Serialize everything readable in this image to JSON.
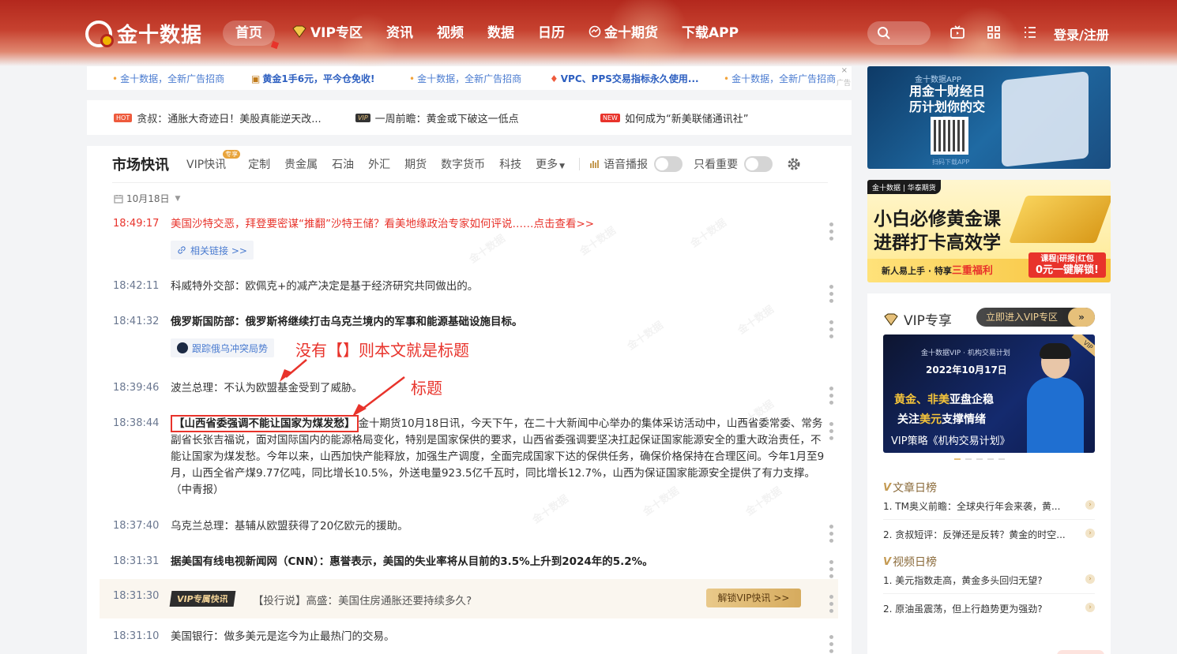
{
  "header": {
    "logo_text": "金十数据",
    "nav": [
      {
        "label": "首页",
        "active": true
      },
      {
        "label": "VIP专区",
        "icon": "vip-diamond-icon"
      },
      {
        "label": "资讯"
      },
      {
        "label": "视频"
      },
      {
        "label": "数据"
      },
      {
        "label": "日历"
      },
      {
        "label": "金十期货",
        "icon": "futures-icon"
      },
      {
        "label": "下载APP"
      }
    ],
    "login_label": "登录/注册",
    "icons": [
      "search-icon",
      "tv-icon",
      "grid-icon",
      "list-icon"
    ],
    "accent": "#c0392b"
  },
  "ad_bar": {
    "items": [
      "金十数据，全新广告招商",
      "黄金1手6元，平今仓免收!",
      "金十数据，全新广告招商",
      "VPC、PPS交易指标永久使用...",
      "金十数据，全新广告招商"
    ],
    "close": "×",
    "tag": "广告"
  },
  "headlines": [
    {
      "tag": "HOT",
      "text": "贪叔：通胀大奇迹日！美股真能逆天改..."
    },
    {
      "tag": "VIP",
      "text": "一周前瞻：黄金或下破这一低点"
    },
    {
      "tag": "NEW",
      "text": "如何成为“新美联储通讯社”"
    }
  ],
  "flash": {
    "tabs": [
      "市场快讯",
      "VIP快讯",
      "定制",
      "贵金属",
      "石油",
      "外汇",
      "期货",
      "数字货币",
      "科技",
      "更多"
    ],
    "vip_sup": "专享",
    "voice_label": "语音播报",
    "important_label": "只看重要",
    "date": "10月18日",
    "items": [
      {
        "time": "18:49:17",
        "text": "美国沙特交恶，拜登要密谋“推翻”沙特王储？看美地缘政治专家如何评说……点击查看>>",
        "chip": "相关链接 >>"
      },
      {
        "time": "18:42:11",
        "text": "科威特外交部：欧佩克+的减产决定是基于经济研究共同做出的。"
      },
      {
        "time": "18:41:32",
        "text": "俄罗斯国防部：俄罗斯将继续打击乌克兰境内的军事和能源基础设施目标。",
        "chip": "跟踪俄乌冲突局势"
      },
      {
        "time": "18:39:46",
        "text": "波兰总理：不认为欧盟基金受到了威胁。"
      },
      {
        "time": "18:38:44",
        "title": "【山西省委强调不能让国家为煤发愁】",
        "text": "金十期货10月18日讯，今天下午，在二十大新闻中心举办的集体采访活动中，山西省委常委、常务副省长张吉福说，面对国际国内的能源格局变化，特别是国家保供的要求，山西省委强调要坚决扛起保证国家能源安全的重大政治责任，不能让国家为煤发愁。今年以来，山西加快产能释放，加强生产调度，全面完成国家下达的保供任务，确保价格保持在合理区间。今年1月至9月，山西全省产煤9.77亿吨，同比增长10.5%，外送电量923.5亿千瓦时，同比增长12.7%，山西为保证国家能源安全提供了有力支撑。（中青报）"
      },
      {
        "time": "18:37:40",
        "text": "乌克兰总理：基辅从欧盟获得了20亿欧元的援助。"
      },
      {
        "time": "18:31:31",
        "text": "据美国有线电视新闻网（CNN）：惠誉表示，美国的失业率将从目前的3.5%上升到2024年的5.2%。"
      },
      {
        "time": "18:31:30",
        "badge": "VIP专属快讯",
        "text": "【投行说】高盛：美国住房通胀还要持续多久?",
        "button": "解锁VIP快讯 >>"
      },
      {
        "time": "18:31:10",
        "text": "美国银行：做多美元是迄今为止最热门的交易。"
      }
    ],
    "watermark": "金十数据"
  },
  "annotations": {
    "a1": "没有【】则本文就是标题",
    "a2": "标题"
  },
  "sidebar": {
    "banner1": {
      "small": "金十数据APP",
      "title": "用金十财经日历计划你的交易",
      "foot": "扫码下载APP"
    },
    "banner2": {
      "brand": "金十数据 | 华泰期货",
      "line1": "小白必修黄金课",
      "line2": "进群打卡高效学",
      "strip_a": "新人易上手 · 特享",
      "strip_b": "三重福利",
      "btn1": "课程|研报|红包",
      "btn2": "0元一键解锁!"
    },
    "vip": {
      "title": "VIP专享",
      "enter": "立即进入VIP专区",
      "card": {
        "small": "金十数据VIP · 机构交易计划",
        "date": "2022年10月17日",
        "l1a": "黄金、非美",
        "l1b": "亚盘企稳",
        "l2a": "关注",
        "l2b": "美元",
        "l2c": "支撑情绪",
        "l3": "VIP策略《机构交易计划》",
        "ribbon": "VIP"
      },
      "article_rank_title": "文章日榜",
      "articles": [
        "1.  TM奥义前瞻：全球央行年会来袭，黄...",
        "2.  贪叔短评：反弹还是反转？黄金的时空..."
      ],
      "video_rank_title": "视频日榜",
      "videos": [
        "1.  美元指数走高，黄金多头回归无望?",
        "2.  原油虽震荡，但上行趋势更为强劲?"
      ]
    }
  }
}
